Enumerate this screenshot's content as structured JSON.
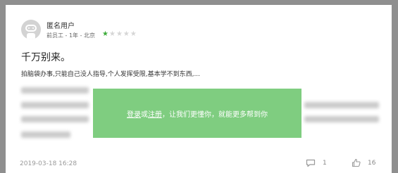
{
  "review": {
    "username": "匿名用户",
    "meta": "前员工 - 1年 - 北京",
    "rating": 1,
    "max_rating": 5,
    "title": "千万别来。",
    "content": "拍脑袋办事,只能自己没人指导,个人发挥受限,基本学不到东西,...",
    "date": "2019-03-18 16:28",
    "comment_count": "1",
    "like_count": "16"
  },
  "overlay": {
    "login_label": "登录",
    "or_label": " 或 ",
    "register_label": "注册",
    "message": "，让我们更懂你，就能更多帮到你"
  },
  "icons": {
    "avatar": "robot-avatar-icon",
    "star": "star-icon",
    "comment": "comment-icon",
    "like": "thumbs-up-icon"
  },
  "colors": {
    "accent": "#3dac3a",
    "overlay": "#7fcd80"
  }
}
